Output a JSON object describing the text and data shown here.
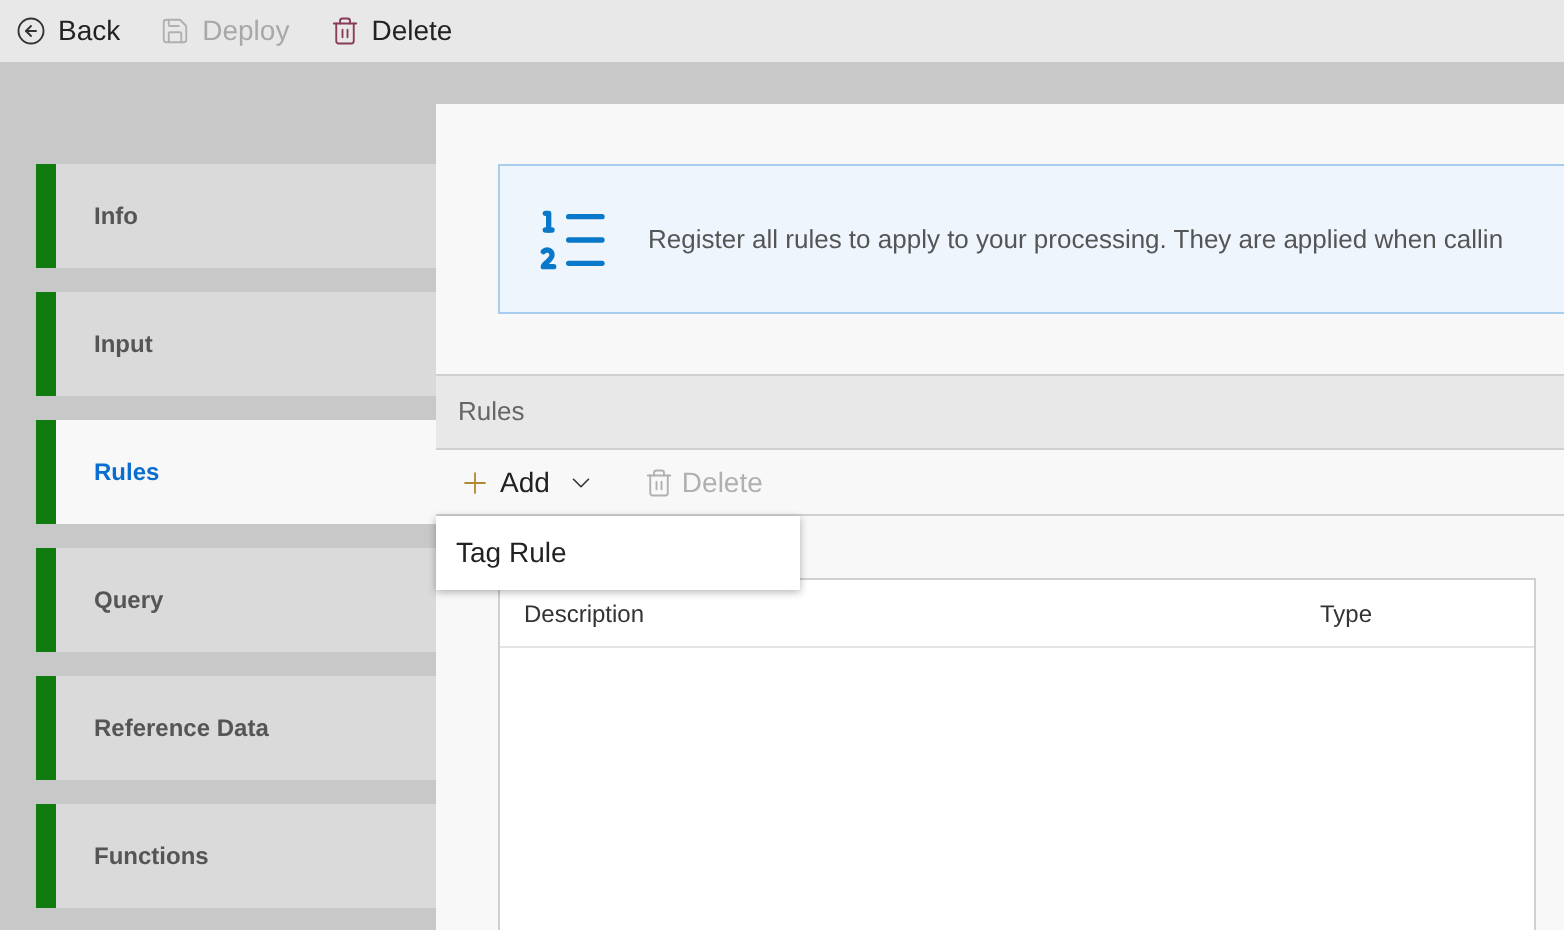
{
  "toolbar": [
    {
      "kind": "back",
      "label": "Back",
      "disabled": false
    },
    {
      "kind": "save",
      "label": "Deploy",
      "disabled": true
    },
    {
      "kind": "delete",
      "label": "Delete",
      "disabled": false
    }
  ],
  "sidebar": {
    "items": [
      {
        "label": "Info",
        "selected": false
      },
      {
        "label": "Input",
        "selected": false
      },
      {
        "label": "Rules",
        "selected": true
      },
      {
        "label": "Query",
        "selected": false
      },
      {
        "label": "Reference Data",
        "selected": false
      },
      {
        "label": "Functions",
        "selected": false
      }
    ]
  },
  "info_banner": {
    "text": "Register all rules to apply to your processing. They are applied when callin"
  },
  "rules": {
    "title": "Rules",
    "actions": [
      {
        "kind": "add",
        "label": "Add",
        "disabled": false
      },
      {
        "kind": "delete",
        "label": "Delete",
        "disabled": true
      }
    ],
    "add_menu": {
      "expanded": true,
      "items": [
        "Tag Rule"
      ]
    },
    "table": {
      "columns": [
        "Description",
        "Type"
      ]
    }
  }
}
